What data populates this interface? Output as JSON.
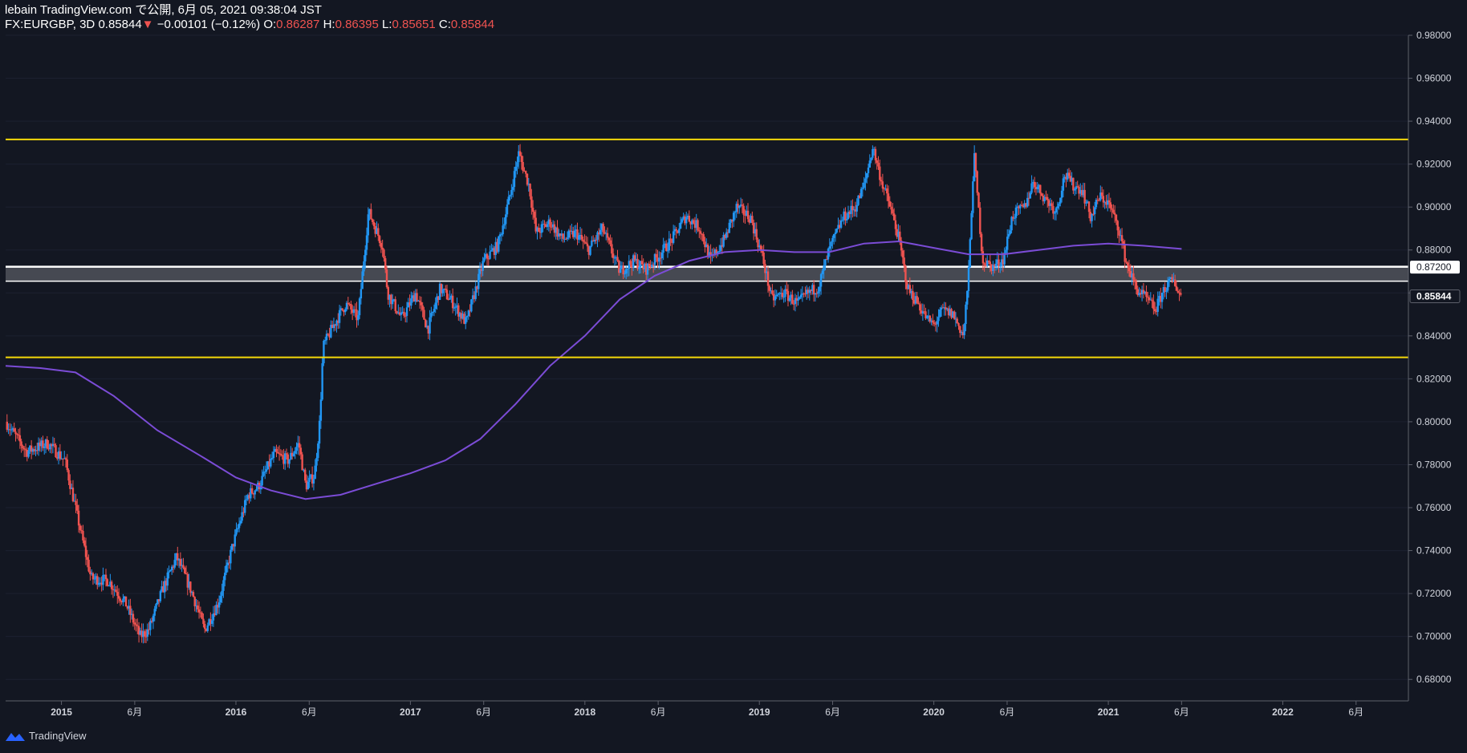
{
  "header": {
    "line1": "lebain TradingView.com で公開, 6月 05, 2021 09:38:04 JST",
    "symbol": "FX:EURGBP, 3D",
    "price": "0.85844",
    "down_arrow": "▼",
    "change": "−0.00101 (−0.12%)",
    "o_label": "O:",
    "o_value": "0.86287",
    "h_label": "H:",
    "h_value": "0.86395",
    "l_label": "L:",
    "l_value": "0.85651",
    "c_label": "C:",
    "c_value": "0.85844"
  },
  "footer": {
    "brand": "TradingView"
  },
  "colors": {
    "background": "#131722",
    "up": "#2196f3",
    "down": "#ef5350",
    "ma": "#7b4cd6",
    "support_resistance": "#f5d90a",
    "zone": "#ffffff",
    "axis_text": "#d1d4dc",
    "axis_line": "#5d606b"
  },
  "chart_data": {
    "type": "candlestick",
    "symbol": "FX:EURGBP",
    "timeframe": "3D",
    "ylim": [
      0.67,
      0.98
    ],
    "y_ticks": [
      "0.98000",
      "0.96000",
      "0.94000",
      "0.92000",
      "0.90000",
      "0.88000",
      "0.86000",
      "0.84000",
      "0.82000",
      "0.80000",
      "0.78000",
      "0.76000",
      "0.74000",
      "0.72000",
      "0.70000",
      "0.68000"
    ],
    "x_ticks": [
      {
        "label": "2015",
        "t": 2015.0,
        "bold": true
      },
      {
        "label": "6月",
        "t": 2015.42
      },
      {
        "label": "2016",
        "t": 2016.0,
        "bold": true
      },
      {
        "label": "6月",
        "t": 2016.42
      },
      {
        "label": "2017",
        "t": 2017.0,
        "bold": true
      },
      {
        "label": "6月",
        "t": 2017.42
      },
      {
        "label": "2018",
        "t": 2018.0,
        "bold": true
      },
      {
        "label": "6月",
        "t": 2018.42
      },
      {
        "label": "2019",
        "t": 2019.0,
        "bold": true
      },
      {
        "label": "6月",
        "t": 2019.42
      },
      {
        "label": "2020",
        "t": 2020.0,
        "bold": true
      },
      {
        "label": "6月",
        "t": 2020.42
      },
      {
        "label": "2021",
        "t": 2021.0,
        "bold": true
      },
      {
        "label": "6月",
        "t": 2021.42
      },
      {
        "label": "2022",
        "t": 2022.0,
        "bold": true
      },
      {
        "label": "6月",
        "t": 2022.42
      }
    ],
    "horizontal_lines": [
      {
        "price": 0.9315,
        "kind": "resistance"
      },
      {
        "price": 0.83,
        "kind": "support"
      }
    ],
    "zone": {
      "top": 0.8722,
      "bottom": 0.8655
    },
    "price_labels": [
      {
        "value": "0.87200",
        "price": 0.872,
        "style": "zone"
      },
      {
        "value": "0.85844",
        "price": 0.85844,
        "style": "last"
      }
    ],
    "close_path": [
      [
        2014.68,
        0.8
      ],
      [
        2014.8,
        0.786
      ],
      [
        2014.92,
        0.79
      ],
      [
        2015.02,
        0.782
      ],
      [
        2015.08,
        0.76
      ],
      [
        2015.17,
        0.727
      ],
      [
        2015.27,
        0.726
      ],
      [
        2015.37,
        0.715
      ],
      [
        2015.45,
        0.7
      ],
      [
        2015.5,
        0.703
      ],
      [
        2015.58,
        0.722
      ],
      [
        2015.66,
        0.737
      ],
      [
        2015.75,
        0.72
      ],
      [
        2015.82,
        0.703
      ],
      [
        2015.9,
        0.716
      ],
      [
        2015.98,
        0.742
      ],
      [
        2016.07,
        0.766
      ],
      [
        2016.13,
        0.77
      ],
      [
        2016.22,
        0.785
      ],
      [
        2016.3,
        0.782
      ],
      [
        2016.36,
        0.79
      ],
      [
        2016.4,
        0.77
      ],
      [
        2016.45,
        0.775
      ],
      [
        2016.48,
        0.8
      ],
      [
        2016.5,
        0.835
      ],
      [
        2016.56,
        0.845
      ],
      [
        2016.63,
        0.855
      ],
      [
        2016.7,
        0.848
      ],
      [
        2016.76,
        0.898
      ],
      [
        2016.84,
        0.882
      ],
      [
        2016.87,
        0.86
      ],
      [
        2016.95,
        0.848
      ],
      [
        2017.03,
        0.86
      ],
      [
        2017.1,
        0.843
      ],
      [
        2017.17,
        0.862
      ],
      [
        2017.23,
        0.857
      ],
      [
        2017.32,
        0.846
      ],
      [
        2017.42,
        0.875
      ],
      [
        2017.5,
        0.882
      ],
      [
        2017.57,
        0.905
      ],
      [
        2017.62,
        0.925
      ],
      [
        2017.68,
        0.91
      ],
      [
        2017.72,
        0.888
      ],
      [
        2017.8,
        0.893
      ],
      [
        2017.87,
        0.885
      ],
      [
        2017.95,
        0.888
      ],
      [
        2018.02,
        0.88
      ],
      [
        2018.1,
        0.89
      ],
      [
        2018.2,
        0.87
      ],
      [
        2018.28,
        0.875
      ],
      [
        2018.35,
        0.871
      ],
      [
        2018.43,
        0.878
      ],
      [
        2018.5,
        0.885
      ],
      [
        2018.58,
        0.896
      ],
      [
        2018.66,
        0.89
      ],
      [
        2018.72,
        0.875
      ],
      [
        2018.8,
        0.885
      ],
      [
        2018.87,
        0.9
      ],
      [
        2018.95,
        0.895
      ],
      [
        2019.02,
        0.876
      ],
      [
        2019.07,
        0.857
      ],
      [
        2019.14,
        0.86
      ],
      [
        2019.22,
        0.855
      ],
      [
        2019.28,
        0.86
      ],
      [
        2019.34,
        0.863
      ],
      [
        2019.4,
        0.88
      ],
      [
        2019.48,
        0.895
      ],
      [
        2019.55,
        0.9
      ],
      [
        2019.6,
        0.91
      ],
      [
        2019.65,
        0.928
      ],
      [
        2019.7,
        0.912
      ],
      [
        2019.75,
        0.9
      ],
      [
        2019.8,
        0.885
      ],
      [
        2019.85,
        0.862
      ],
      [
        2019.91,
        0.855
      ],
      [
        2019.96,
        0.848
      ],
      [
        2020.0,
        0.845
      ],
      [
        2020.05,
        0.852
      ],
      [
        2020.11,
        0.85
      ],
      [
        2020.17,
        0.84
      ],
      [
        2020.2,
        0.87
      ],
      [
        2020.23,
        0.925
      ],
      [
        2020.25,
        0.905
      ],
      [
        2020.28,
        0.875
      ],
      [
        2020.34,
        0.872
      ],
      [
        2020.4,
        0.876
      ],
      [
        2020.45,
        0.896
      ],
      [
        2020.52,
        0.9
      ],
      [
        2020.57,
        0.912
      ],
      [
        2020.63,
        0.905
      ],
      [
        2020.7,
        0.898
      ],
      [
        2020.75,
        0.915
      ],
      [
        2020.8,
        0.91
      ],
      [
        2020.85,
        0.908
      ],
      [
        2020.9,
        0.895
      ],
      [
        2020.95,
        0.905
      ],
      [
        2021.0,
        0.902
      ],
      [
        2021.06,
        0.89
      ],
      [
        2021.1,
        0.875
      ],
      [
        2021.16,
        0.862
      ],
      [
        2021.22,
        0.857
      ],
      [
        2021.27,
        0.852
      ],
      [
        2021.32,
        0.862
      ],
      [
        2021.37,
        0.866
      ],
      [
        2021.42,
        0.858
      ]
    ],
    "ma_path": [
      [
        2014.68,
        0.826
      ],
      [
        2014.88,
        0.825
      ],
      [
        2015.08,
        0.823
      ],
      [
        2015.3,
        0.812
      ],
      [
        2015.55,
        0.796
      ],
      [
        2015.8,
        0.784
      ],
      [
        2016.0,
        0.774
      ],
      [
        2016.2,
        0.768
      ],
      [
        2016.4,
        0.764
      ],
      [
        2016.6,
        0.766
      ],
      [
        2016.8,
        0.771
      ],
      [
        2017.0,
        0.776
      ],
      [
        2017.2,
        0.782
      ],
      [
        2017.4,
        0.792
      ],
      [
        2017.6,
        0.808
      ],
      [
        2017.8,
        0.826
      ],
      [
        2018.0,
        0.84
      ],
      [
        2018.2,
        0.857
      ],
      [
        2018.4,
        0.868
      ],
      [
        2018.6,
        0.875
      ],
      [
        2018.8,
        0.879
      ],
      [
        2019.0,
        0.88
      ],
      [
        2019.2,
        0.879
      ],
      [
        2019.4,
        0.879
      ],
      [
        2019.6,
        0.883
      ],
      [
        2019.8,
        0.884
      ],
      [
        2020.0,
        0.881
      ],
      [
        2020.2,
        0.878
      ],
      [
        2020.4,
        0.878
      ],
      [
        2020.6,
        0.88
      ],
      [
        2020.8,
        0.882
      ],
      [
        2021.0,
        0.883
      ],
      [
        2021.2,
        0.882
      ],
      [
        2021.42,
        0.8805
      ]
    ]
  }
}
